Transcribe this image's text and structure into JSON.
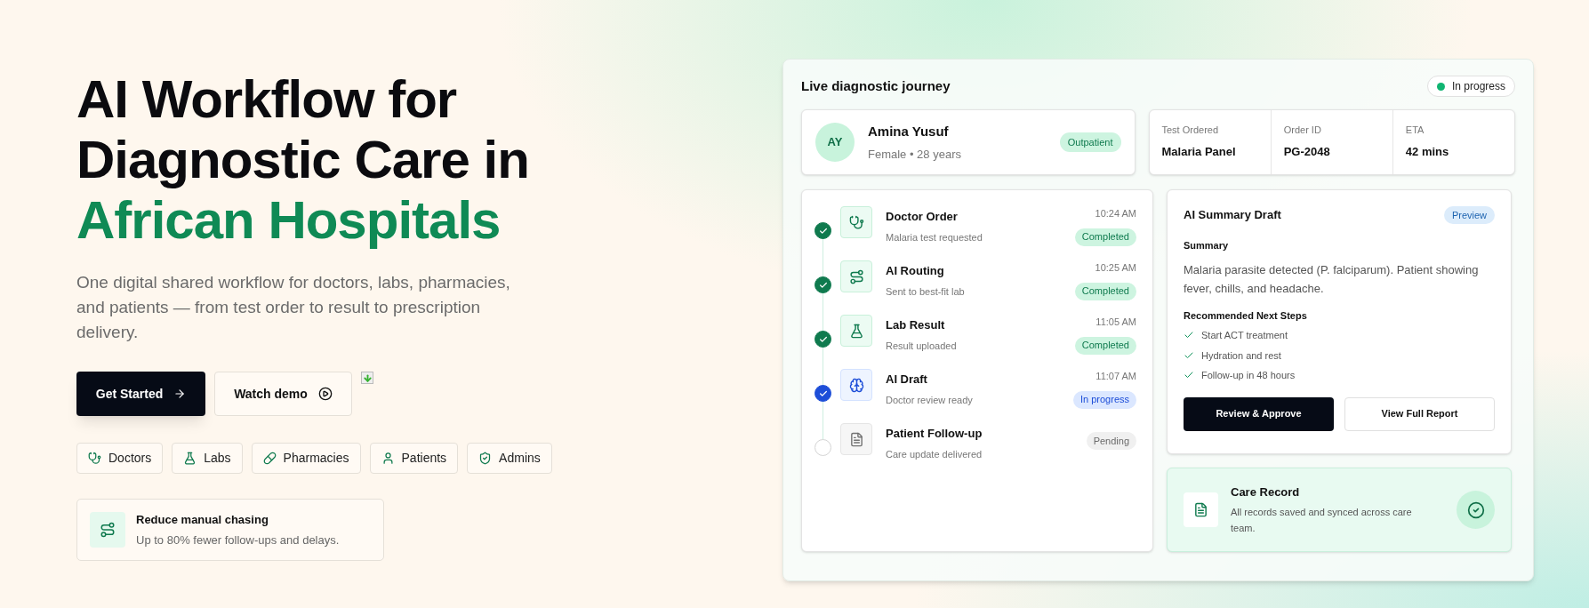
{
  "hero": {
    "title_lines": [
      "AI Workflow for",
      "Diagnostic Care in"
    ],
    "title_highlight": "African Hospitals",
    "description": "One digital shared workflow for doctors, labs, pharmacies, and patients — from test order to result to prescription delivery.",
    "primary_button": "Get Started",
    "secondary_button": "Watch demo",
    "roles": [
      "Doctors",
      "Labs",
      "Pharmacies",
      "Patients",
      "Admins"
    ],
    "highlight": {
      "title": "Reduce manual chasing",
      "text": "Up to 80% fewer follow-ups and delays."
    }
  },
  "journey": {
    "title": "Live diagnostic journey",
    "status": "In progress",
    "patient": {
      "initials": "AY",
      "name": "Amina Yusuf",
      "details": "Female • 28 years",
      "badge": "Outpatient"
    },
    "info": [
      {
        "label": "Test Ordered",
        "value": "Malaria Panel"
      },
      {
        "label": "Order ID",
        "value": "PG-2048"
      },
      {
        "label": "ETA",
        "value": "42 mins"
      }
    ],
    "steps": [
      {
        "title": "Doctor Order",
        "subtitle": "Malaria test requested",
        "time": "10:24 AM",
        "badge": "Completed",
        "kind": "completed"
      },
      {
        "title": "AI Routing",
        "subtitle": "Sent to best-fit lab",
        "time": "10:25 AM",
        "badge": "Completed",
        "kind": "completed"
      },
      {
        "title": "Lab Result",
        "subtitle": "Result uploaded",
        "time": "11:05 AM",
        "badge": "Completed",
        "kind": "completed"
      },
      {
        "title": "AI Draft",
        "subtitle": "Doctor review ready",
        "time": "11:07 AM",
        "badge": "In progress",
        "kind": "active"
      },
      {
        "title": "Patient Follow-up",
        "subtitle": "Care update delivered",
        "badge": "Pending",
        "kind": "pending"
      }
    ],
    "summary": {
      "title": "AI Summary Draft",
      "badge": "Preview",
      "summary_label": "Summary",
      "summary_text": "Malaria parasite detected (P. falciparum). Patient showing fever, chills, and headache.",
      "steps_label": "Recommended Next Steps",
      "next_steps": [
        "Start ACT treatment",
        "Hydration and rest",
        "Follow-up in 48 hours"
      ],
      "primary_button": "Review & Approve",
      "secondary_button": "View Full Report"
    },
    "care_record": {
      "title": "Care Record",
      "text": "All records saved and synced across care team."
    }
  }
}
